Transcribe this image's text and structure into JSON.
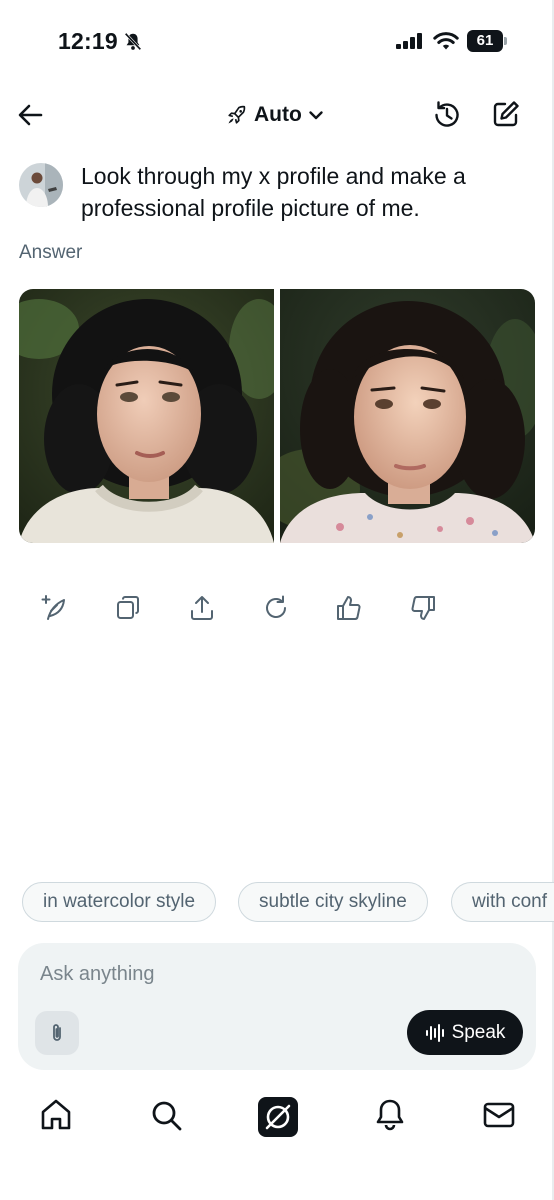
{
  "status_bar": {
    "time": "12:19",
    "battery": "61"
  },
  "header": {
    "mode_label": "Auto"
  },
  "conversation": {
    "prompt": "Look through my x profile and make a professional profile picture of me.",
    "answer_label": "Answer"
  },
  "suggestions": [
    "in watercolor style",
    "subtle city skyline",
    "with conf"
  ],
  "composer": {
    "placeholder": "Ask anything",
    "speak_label": "Speak"
  },
  "icons": {
    "header": [
      "back-arrow-icon",
      "rocket-icon",
      "chevron-down-icon",
      "history-icon",
      "compose-icon"
    ],
    "actions": [
      "edit-image-icon",
      "copy-icon",
      "share-icon",
      "regenerate-icon",
      "thumbs-up-icon",
      "thumbs-down-icon"
    ],
    "tabs": [
      "home-icon",
      "search-icon",
      "grok-icon",
      "notifications-icon",
      "messages-icon"
    ]
  },
  "colors": {
    "text": "#0f1419",
    "secondary": "#536471",
    "input_bg": "#eff3f4",
    "speak_bg": "#0f1419"
  }
}
